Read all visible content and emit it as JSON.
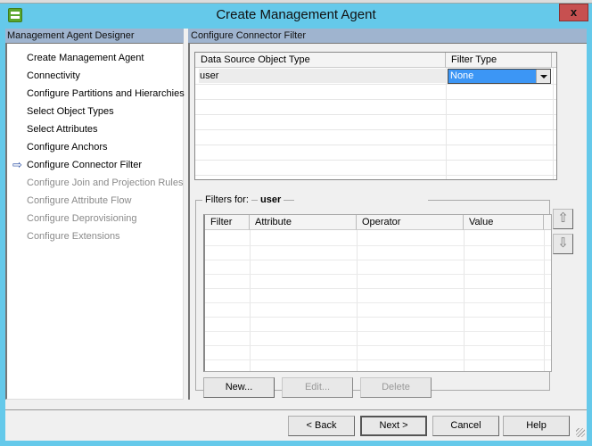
{
  "window": {
    "title": "Create Management Agent",
    "close_label": "x",
    "icon": "app-sync-icon"
  },
  "left": {
    "header": "Management Agent Designer",
    "current_marker_icon": "arrow-right-icon",
    "current_marker_glyph": "⇨",
    "items": [
      {
        "label": "Create Management Agent",
        "state": "enabled"
      },
      {
        "label": "Connectivity",
        "state": "enabled"
      },
      {
        "label": "Configure Partitions and Hierarchies",
        "state": "enabled"
      },
      {
        "label": "Select Object Types",
        "state": "enabled"
      },
      {
        "label": "Select Attributes",
        "state": "enabled"
      },
      {
        "label": "Configure Anchors",
        "state": "enabled"
      },
      {
        "label": "Configure Connector Filter",
        "state": "current"
      },
      {
        "label": "Configure Join and Projection Rules",
        "state": "disabled"
      },
      {
        "label": "Configure Attribute Flow",
        "state": "disabled"
      },
      {
        "label": "Configure Deprovisioning",
        "state": "disabled"
      },
      {
        "label": "Configure Extensions",
        "state": "disabled"
      }
    ]
  },
  "right": {
    "header": "Configure Connector Filter",
    "object_grid": {
      "columns": [
        "Data Source Object Type",
        "Filter Type"
      ],
      "rows": [
        {
          "object_type": "user",
          "filter_type": "None"
        }
      ]
    },
    "filters": {
      "label": "Filters for:",
      "object": "user",
      "columns": [
        "Filter",
        "Attribute",
        "Operator",
        "Value"
      ],
      "rows": [],
      "move_up_glyph": "⇧",
      "move_down_glyph": "⇩",
      "buttons": {
        "new": "New...",
        "edit": "Edit...",
        "delete": "Delete"
      }
    }
  },
  "footer": {
    "back": "< Back",
    "next": "Next >",
    "cancel": "Cancel",
    "help": "Help"
  },
  "colors": {
    "titlebar": "#65c9ea",
    "close": "#c75050",
    "pane_header": "#9fb4cf",
    "selection": "#3c96f5"
  }
}
